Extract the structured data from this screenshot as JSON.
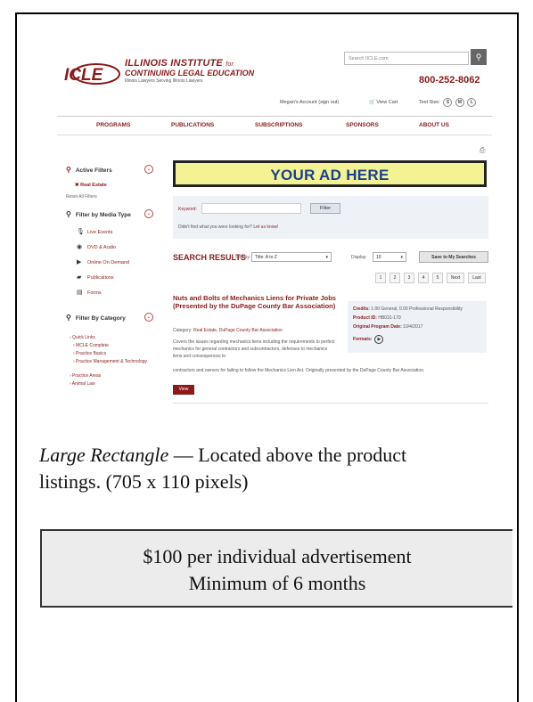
{
  "site": {
    "logo_text": "ICLE",
    "institute_line": "ILLINOIS INSTITUTE",
    "institute_for": "for",
    "cle_line": "CONTINUING LEGAL EDUCATION",
    "tagline": "Illinois Lawyers Serving Illinois Lawyers",
    "search_placeholder": "Search IICLE.com",
    "phone": "800-252-8062",
    "account": "Megan's Account (sign out)",
    "cart": "View Cart",
    "text_size_label": "Text Size:",
    "text_sizes": [
      "S",
      "M",
      "L"
    ],
    "nav": [
      "PROGRAMS",
      "PUBLICATIONS",
      "SUBSCRIPTIONS",
      "SPONSORS",
      "ABOUT US"
    ],
    "sidebar": {
      "active_filters": "Active Filters",
      "active_filter_item": "Real Estate",
      "reset_filters": "Reset All Filters",
      "filter_media": "Filter by Media Type",
      "media_items": [
        {
          "icon": "microphone-icon",
          "glyph": "🎙",
          "label": "Live Events"
        },
        {
          "icon": "disc-icon",
          "glyph": "◉",
          "label": "DVD & Audio"
        },
        {
          "icon": "play-icon",
          "glyph": "▶",
          "label": "Online On Demand"
        },
        {
          "icon": "book-icon",
          "glyph": "▰",
          "label": "Publications"
        },
        {
          "icon": "forms-icon",
          "glyph": "▤",
          "label": "Forms"
        }
      ],
      "filter_category": "Filter By Category",
      "category_items": [
        "Quick Links",
        "MCLE Complete",
        "Practice Basics",
        "Practice Management & Technology",
        "Practice Areas",
        "Animal Law"
      ]
    },
    "ad_text": "YOUR AD HERE",
    "keyword_label": "Keyword:",
    "filter_button": "Filter",
    "help_text": "Didn't find what you were looking for?",
    "help_link": "Let us know!",
    "search_results": "SEARCH RESULTS",
    "sort_label": "Sort by:",
    "sort_value": "Title: A to Z",
    "display_label": "Display:",
    "display_value": "10",
    "save_button": "Save to My Searches",
    "pager": [
      "1",
      "2",
      "3",
      "4",
      "5",
      "Next",
      "Last"
    ],
    "result": {
      "title": "Nuts and Bolts of Mechanics Liens for Private Jobs (Presented by the DuPage County Bar Association)",
      "category_label": "Category:",
      "category_value": "Real Estate, DuPage County Bar Association",
      "description": "Covers the issues regarding mechanics liens including the requirements to perfect mechanics for general contractors and subcontractors, defenses to mechanics liens and consequences to",
      "description_tail": "contractors and owners for failing to follow the Mechanics Lien Act. Originally presented by the DuPage County Bar Association.",
      "credits_label": "Credits:",
      "credits_value": "1.00 General, 0.00 Professional Responsibility",
      "product_label": "Product ID:",
      "product_value": "HB031-170",
      "date_label": "Original Program Date:",
      "date_value": "10/4/2017",
      "format_label": "Formats:",
      "view_button": "View"
    }
  },
  "caption": {
    "italic": "Large Rectangle",
    "rest": " — Located above the product",
    "line2": "listings. (705 x 110 pixels)"
  },
  "pricing": {
    "line1": "$100 per individual advertisement",
    "line2": "Minimum of 6 months"
  }
}
